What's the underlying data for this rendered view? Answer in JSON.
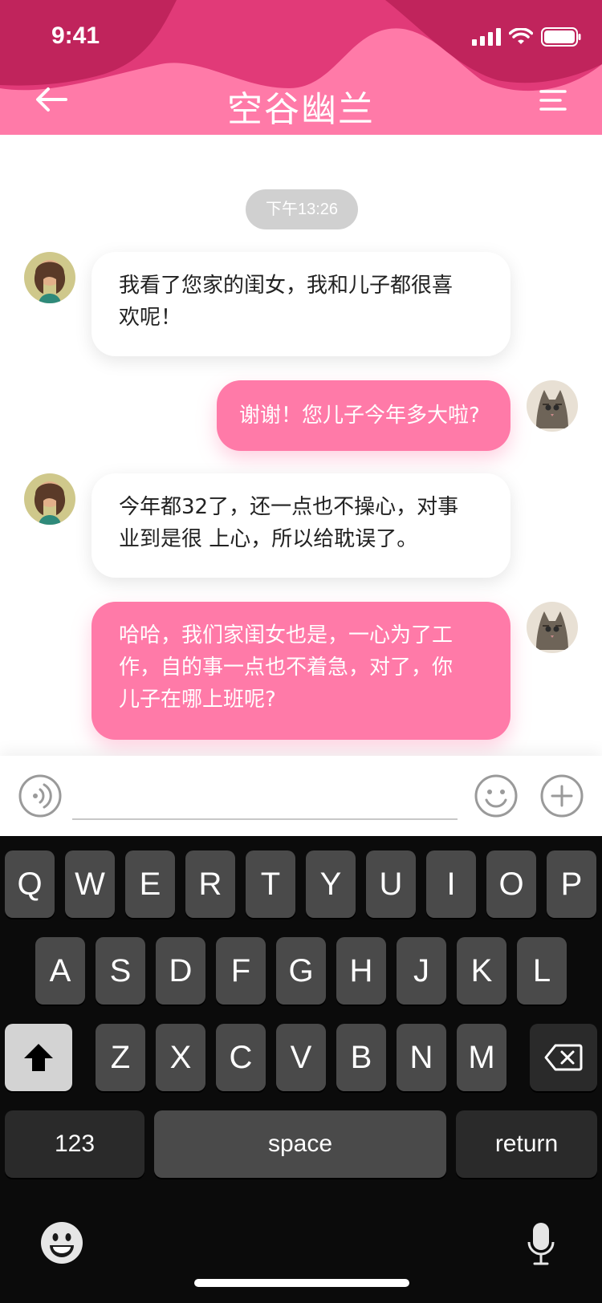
{
  "status": {
    "time": "9:41"
  },
  "header": {
    "title": "空谷幽兰"
  },
  "chat": {
    "timestamp": "下午13:26",
    "messages": [
      {
        "side": "in",
        "lines": [
          "我看了您家的闺女，我和儿子都很喜",
          "欢呢！"
        ]
      },
      {
        "side": "out",
        "lines": [
          "谢谢！您儿子今年多大啦?"
        ]
      },
      {
        "side": "in",
        "lines": [
          "今年都32了，还一点也不操心，对事",
          "业到是很 上心，所以给耽误了。"
        ]
      },
      {
        "side": "out",
        "lines": [
          "哈哈，我们家闺女也是，一心为了工",
          "作，自的事一点也不着急，对了，你",
          "儿子在哪上班呢?"
        ]
      }
    ]
  },
  "input": {
    "placeholder": ""
  },
  "keyboard": {
    "row1": [
      "Q",
      "W",
      "E",
      "R",
      "T",
      "Y",
      "U",
      "I",
      "O",
      "P"
    ],
    "row2": [
      "A",
      "S",
      "D",
      "F",
      "G",
      "H",
      "J",
      "K",
      "L"
    ],
    "row3": [
      "Z",
      "X",
      "C",
      "V",
      "B",
      "N",
      "M"
    ],
    "numbers_label": "123",
    "space_label": "space",
    "return_label": "return"
  },
  "colors": {
    "accent": "#ff7aa8",
    "header_dark": "#c0245c",
    "keyboard_bg": "#0b0b0b"
  },
  "icons": [
    "back-arrow-icon",
    "menu-icon",
    "signal-icon",
    "wifi-icon",
    "battery-icon",
    "voice-icon",
    "emoji-icon",
    "add-icon",
    "shift-icon",
    "backspace-icon",
    "emoji-keyboard-icon",
    "microphone-icon"
  ]
}
